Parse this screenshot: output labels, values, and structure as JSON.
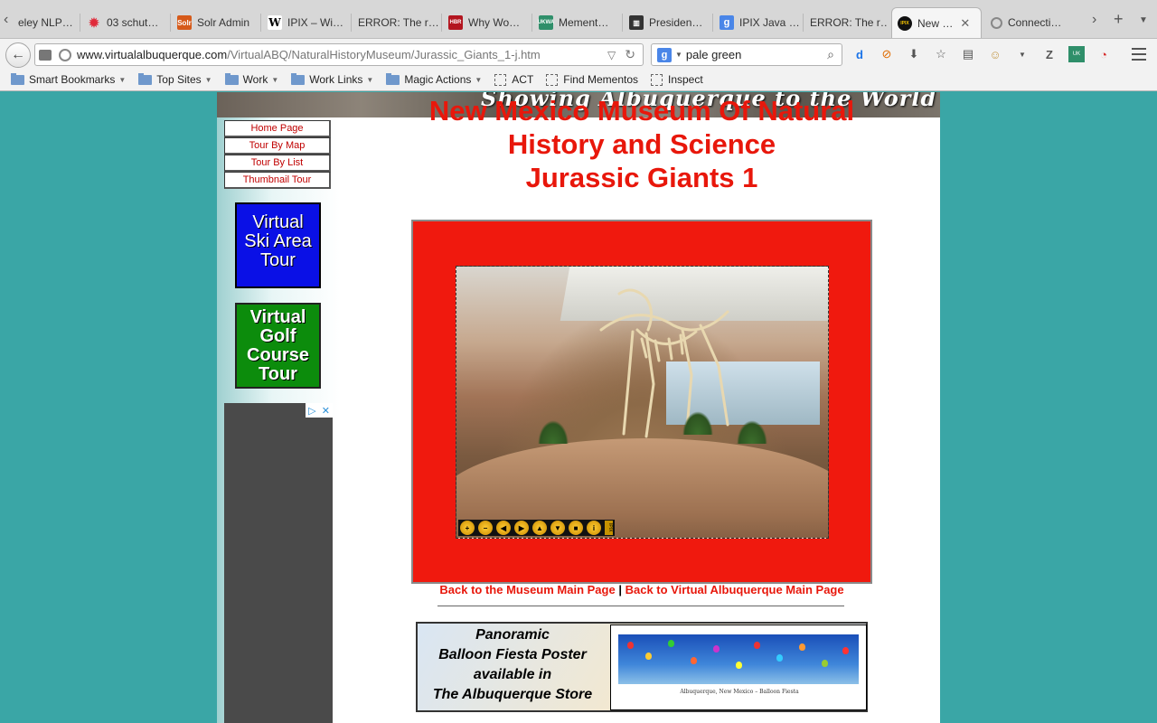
{
  "tabs": [
    {
      "label": "eley NLP…",
      "icon": "book-icon"
    },
    {
      "label": "03 schut…",
      "icon": "red-dots-icon"
    },
    {
      "label": "Solr Admin",
      "icon": "solr-icon"
    },
    {
      "label": "IPIX – Wi…",
      "icon": "wikipedia-icon"
    },
    {
      "label": "ERROR: The r…",
      "icon": "none"
    },
    {
      "label": "Why Wo…",
      "icon": "hbr-icon"
    },
    {
      "label": "Mement…",
      "icon": "ukwa-icon"
    },
    {
      "label": "Presiden…",
      "icon": "archive-icon"
    },
    {
      "label": "IPIX Java …",
      "icon": "google-icon"
    },
    {
      "label": "ERROR: The r…",
      "icon": "none"
    },
    {
      "label": "New …",
      "icon": "ipix-icon",
      "active": true
    },
    {
      "label": "Connecti…",
      "icon": "loading-icon"
    }
  ],
  "url": {
    "domain": "www.virtualalbuquerque.com",
    "path": "/VirtualABQ/NaturalHistoryMuseum/Jurassic_Giants_1-j.htm"
  },
  "search": {
    "value": "pale green",
    "engine": "Google"
  },
  "bookmarks": [
    {
      "label": "Smart Bookmarks",
      "type": "folder"
    },
    {
      "label": "Top Sites",
      "type": "folder"
    },
    {
      "label": "Work",
      "type": "folder"
    },
    {
      "label": "Work Links",
      "type": "folder"
    },
    {
      "label": "Magic Actions",
      "type": "folder"
    },
    {
      "label": "ACT",
      "type": "item"
    },
    {
      "label": "Find Mementos",
      "type": "item"
    },
    {
      "label": "Inspect",
      "type": "item"
    }
  ],
  "page": {
    "banner_text": "Showing Albuquerque to the World",
    "title_lines": [
      "New Mexico Museum Of Natural",
      "History and Science",
      "Jurassic Giants 1"
    ],
    "side_nav": [
      "Home Page",
      "Tour By Map",
      "Tour By List",
      "Thumbnail Tour"
    ],
    "promos": {
      "ski": [
        "Virtual",
        "Ski Area",
        "Tour"
      ],
      "golf": [
        "Virtual",
        "Golf",
        "Course",
        "Tour"
      ]
    },
    "ad_icons": [
      "▷",
      "✕"
    ],
    "back_links": {
      "museum": "Back to the Museum Main Page",
      "separator": "|",
      "main": "Back to Virtual Albuquerque Main Page"
    },
    "poster": {
      "lines": [
        "Panoramic",
        "Balloon Fiesta Poster",
        "available in",
        "The Albuquerque Store"
      ],
      "caption": "Albuquerque, New Mexico – Balloon Fiesta"
    },
    "viewer_controls": [
      "zoom-in",
      "zoom-out",
      "pan-left",
      "pan-right",
      "pan-up",
      "pan-down",
      "stop",
      "info"
    ],
    "viewer_logo": "IPIX"
  },
  "colors": {
    "page_bg": "#3aa6a6",
    "title_red": "#e8170b",
    "frame_red": "#f0190e",
    "ski_blue": "#0a10e6",
    "golf_green": "#0c8c0c"
  }
}
